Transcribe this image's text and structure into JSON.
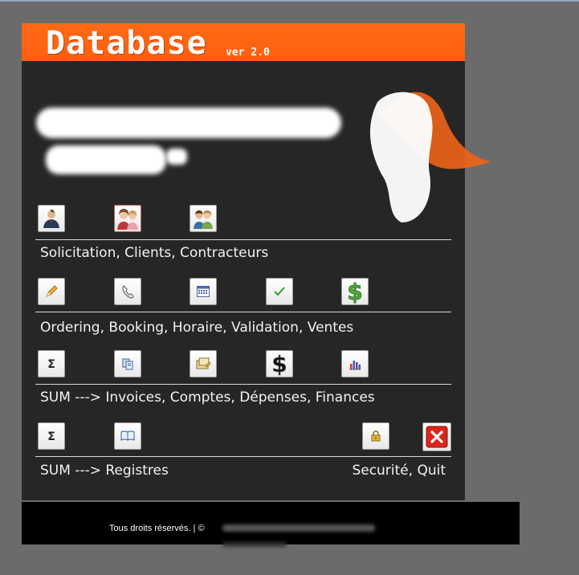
{
  "header": {
    "title": "Database",
    "version": "ver 2.0"
  },
  "sections": [
    {
      "label": "Solicitation, Clients, Contracteurs",
      "buttons": [
        "solicitation-icon",
        "clients-icon",
        "contracteurs-icon"
      ]
    },
    {
      "label": "Ordering, Booking, Horaire, Validation, Ventes",
      "buttons": [
        "pencil-icon",
        "phone-icon",
        "calendar-icon",
        "checkmark-icon",
        "dollar-icon"
      ]
    },
    {
      "label": "SUM ---> Invoices, Comptes, Dépenses, Finances",
      "buttons": [
        "sigma-icon",
        "documents-icon",
        "expenses-icon",
        "dollar-icon",
        "bar-chart-icon"
      ]
    },
    {
      "label_left": "SUM ---> Registres",
      "label_right": "Securité, Quit",
      "buttons": [
        "sigma-icon",
        "book-icon",
        "lock-icon",
        "close-icon"
      ]
    }
  ],
  "footer": {
    "copyright": "Tous droits réservés. | ©"
  },
  "colors": {
    "accent": "#ff6a16",
    "panel": "#262626",
    "background": "#6b6b6b",
    "close": "#d9261c"
  }
}
